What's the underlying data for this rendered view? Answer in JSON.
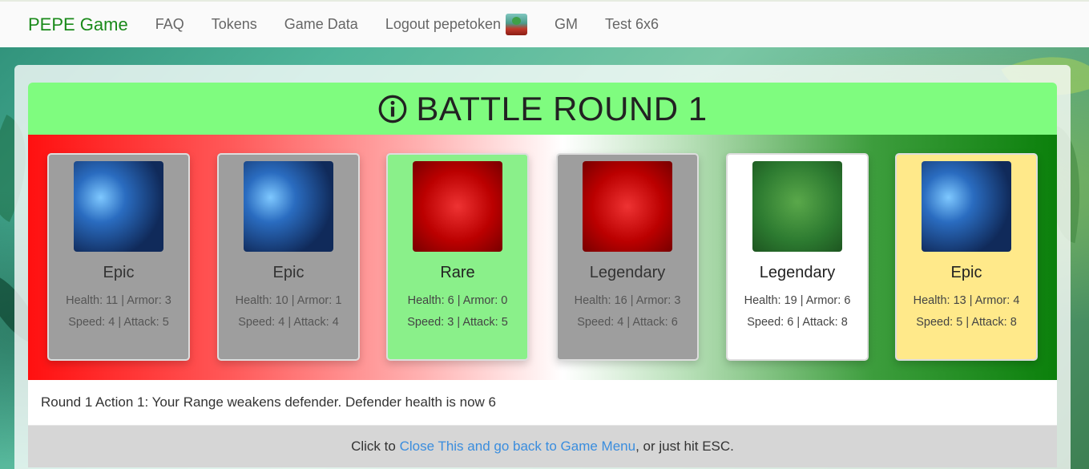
{
  "navbar": {
    "brand": "PEPE Game",
    "items": [
      {
        "label": "FAQ"
      },
      {
        "label": "Tokens"
      },
      {
        "label": "Game Data"
      },
      {
        "label": "Logout pepetoken"
      },
      {
        "label": "GM"
      },
      {
        "label": "Test 6x6"
      }
    ]
  },
  "modal": {
    "title": "BATTLE ROUND 1",
    "cards": [
      {
        "rarity": "Epic",
        "image": "wizard-frog",
        "health": "11",
        "armor": "3",
        "speed": "4",
        "attack": "5",
        "style": "gray"
      },
      {
        "rarity": "Epic",
        "image": "wizard-frog",
        "health": "10",
        "armor": "1",
        "speed": "4",
        "attack": "4",
        "style": "gray"
      },
      {
        "rarity": "Rare",
        "image": "ninja-frog",
        "health": "6",
        "armor": "0",
        "speed": "3",
        "attack": "5",
        "style": "green"
      },
      {
        "rarity": "Legendary",
        "image": "ninja-frog",
        "health": "16",
        "armor": "3",
        "speed": "4",
        "attack": "6",
        "style": "gray"
      },
      {
        "rarity": "Legendary",
        "image": "archer-frog",
        "health": "19",
        "armor": "6",
        "speed": "6",
        "attack": "8",
        "style": "white"
      },
      {
        "rarity": "Epic",
        "image": "wizard-frog",
        "health": "13",
        "armor": "4",
        "speed": "5",
        "attack": "8",
        "style": "yellow"
      }
    ],
    "stat_labels": {
      "health": "Health",
      "armor": "Armor",
      "speed": "Speed",
      "attack": "Attack"
    },
    "log": "Round 1 Action 1: Your Range weakens defender. Defender health is now 6",
    "footer": {
      "prefix": "Click to ",
      "link": "Close This and go back to Game Menu",
      "suffix": ", or just hit ESC."
    }
  },
  "colors": {
    "header_bg": "#7ffc7f",
    "brand": "#1a8a1a",
    "link": "#3a8dde"
  }
}
